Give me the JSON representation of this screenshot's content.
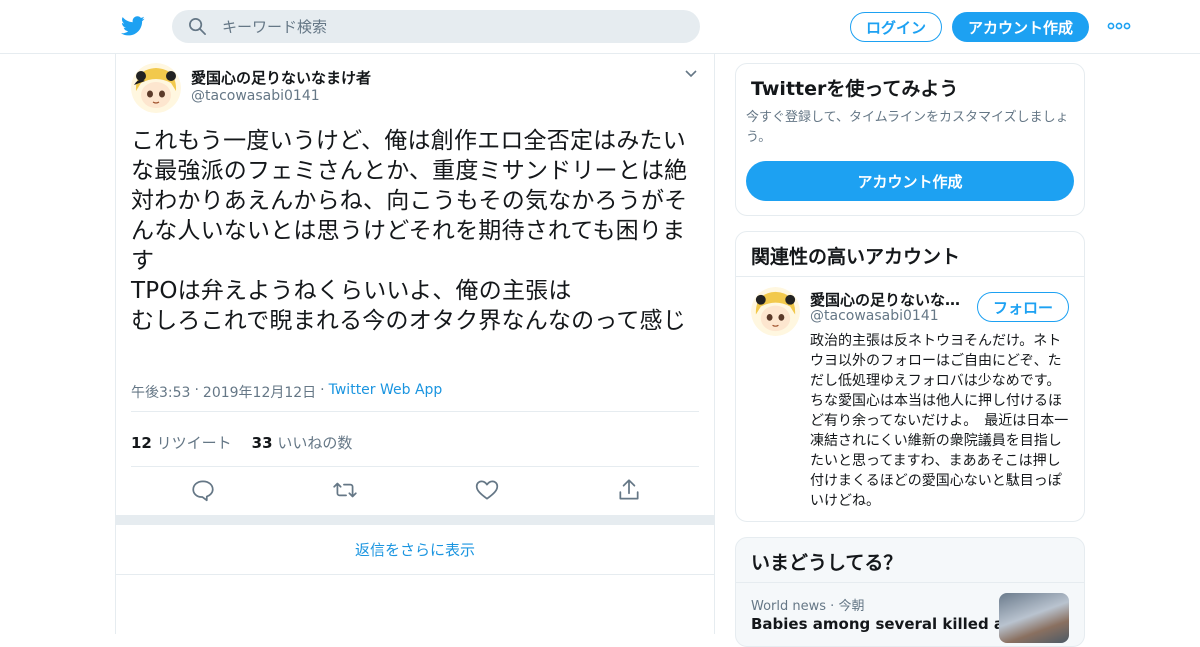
{
  "header": {
    "search_placeholder": "キーワード検索",
    "login_label": "ログイン",
    "signup_label": "アカウント作成",
    "brand_color": "#1da1f2"
  },
  "tweet": {
    "author_name": "愛国心の足りないなまけ者",
    "author_handle": "@tacowasabi0141",
    "text": "これもう一度いうけど、俺は創作エロ全否定はみたいな最強派のフェミさんとか、重度ミサンドリーとは絶対わかりあえんからね、向こうもその気なかろうがそんな人いないとは思うけどそれを期待されても困ります\nTPOは弁えようねくらいいよ、俺の主張は\nむしろこれで睨まれる今のオタク界なんなのって感じ",
    "time": "午後3:53",
    "date": "2019年12月12日",
    "app": "Twitter Web App",
    "retweet_count": "12",
    "retweet_label": "リツイート",
    "like_count": "33",
    "like_label": "いいねの数",
    "show_more_replies": "返信をさらに表示"
  },
  "sidebar": {
    "try_card": {
      "title": "Twitterを使ってみよう",
      "description": "今すぐ登録して、タイムラインをカスタマイズしましょう。",
      "button": "アカウント作成"
    },
    "related_card": {
      "title": "関連性の高いアカウント",
      "name": "愛国心の足りないな…",
      "handle": "@tacowasabi0141",
      "follow_label": "フォロー",
      "bio": "政治的主張は反ネトウヨそんだけ。ネトウヨ以外のフォローはご自由にどぞ、ただし低処理ゆえフォロバは少なめです。　ちな愛国心は本当は他人に押し付けるほど有り余ってないだけよ。　最近は日本一凍結されにくい維新の衆院議員を目指したいと思ってますわ、まああそこは押し付けまくるほどの愛国心ないと駄目っぽいけどね。"
    },
    "trends_card": {
      "title": "いまどうしてる？",
      "category": "World news",
      "when": "今朝",
      "headline": "Babies among several killed as"
    }
  },
  "icons": {
    "logo": "twitter-bird-icon",
    "search": "search-icon",
    "more": "more-dots-icon",
    "caret": "chevron-down-icon",
    "reply": "reply-icon",
    "retweet": "retweet-icon",
    "like": "heart-icon",
    "share": "share-icon"
  }
}
